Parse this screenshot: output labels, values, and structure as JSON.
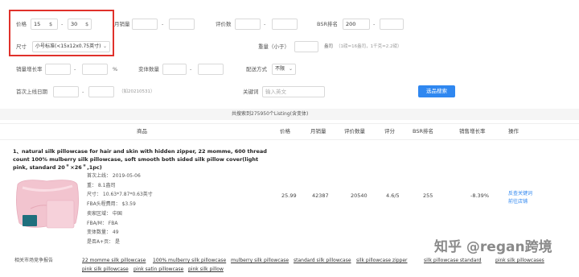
{
  "filters": {
    "price": {
      "label": "价格",
      "min": "15",
      "min_unit": "$",
      "max": "30",
      "max_unit": "$",
      "sep": "-"
    },
    "monthly_sales": {
      "label": "月销量",
      "sep": "-"
    },
    "review_count": {
      "label": "评价数",
      "sep": "-"
    },
    "bsr": {
      "label": "BSR排名",
      "min": "200",
      "sep": "-"
    },
    "size": {
      "label": "尺寸",
      "selected": "小号标准(<15x12x0.75英寸)"
    },
    "weight": {
      "label": "重量（小于）",
      "unit": "盎司",
      "hint": "（1磅=16盎司，1千克=2.2磅）"
    },
    "sales_growth": {
      "label": "销量增长率",
      "sep": "-",
      "unit": "%"
    },
    "variant_count": {
      "label": "变体数量",
      "sep": "-"
    },
    "delivery": {
      "label": "配送方式",
      "selected": "不限"
    },
    "first_listed": {
      "label": "首次上线日期",
      "sep": "-",
      "hint": "（如20210531）"
    },
    "keyword": {
      "label": "关键词",
      "placeholder": "输入英文"
    },
    "search_button": "选品搜索"
  },
  "summary": "共搜索到275950个Listing(含变体)",
  "table": {
    "headers": {
      "product": "商品",
      "price": "价格",
      "monthly_sales": "月销量",
      "review_count": "评价数量",
      "rating": "评分",
      "bsr": "BSR排名",
      "sales_growth": "销售增长率",
      "action": "操作"
    },
    "row": {
      "title": "1、natural silk pillowcase for hair and skin with hidden zipper, 22 momme, 600 thread count 100% mulberry silk pillowcase, soft smooth both sided silk pillow cover(light pink, standard 20＂×26＂,1pc)",
      "meta": [
        "首次上线：  2019-05-06",
        "重：  8.1盎司",
        "尺寸：  10.63*7.87*0.63英寸",
        "FBA头程费用：  $3.59",
        "卖家区域：  中国",
        "FBA/M：  FBA",
        "变体数量：  49",
        "是否A+页：  是"
      ],
      "price": "25.99",
      "monthly_sales": "42387",
      "review_count": "20540",
      "rating": "4.6/5",
      "bsr": "255",
      "sales_growth": "-8.39%",
      "actions": [
        "反查关键词",
        "前往店铺"
      ]
    },
    "keywords_label": "相关市场竞争报告",
    "keywords": [
      "22 momme silk pillowcase",
      "100% mulberry silk pillowcase",
      "mulberry silk pillowcase",
      "standard silk pillowcase",
      "silk pillowcase zipper",
      "silk pillowcase standard",
      "pink silk pillowcases",
      "pink silk pillowcase",
      "pink satin pillowcase",
      "pink silk pillow"
    ]
  },
  "watermark": "知乎 @regan跨境",
  "colors": {
    "accent": "#2f87f0",
    "highlight_box": "#e0312b",
    "pillow": "#f2c4cf"
  }
}
